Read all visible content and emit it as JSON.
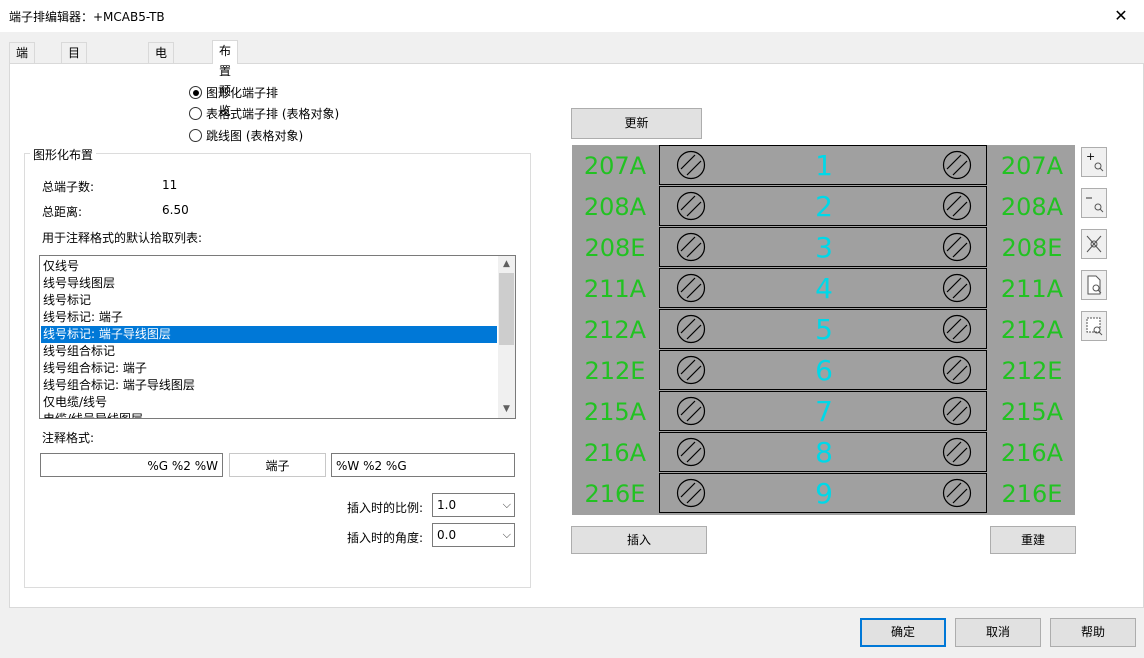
{
  "window": {
    "title": "端子排编辑器：+MCAB5-TB",
    "close_icon": "close-icon"
  },
  "tabs": [
    {
      "label": "端子排"
    },
    {
      "label": "目录代号指定"
    },
    {
      "label": "电缆信息"
    },
    {
      "label": "布置预览",
      "active": true
    }
  ],
  "layout_options": {
    "items": [
      {
        "label": "图形化端子排",
        "selected": true
      },
      {
        "label": "表格式端子排 (表格对象)",
        "selected": false
      },
      {
        "label": "跳线图 (表格对象)",
        "selected": false
      }
    ]
  },
  "graphic_layout": {
    "title": "图形化布置",
    "total_terminals_label": "总端子数:",
    "total_terminals_value": "11",
    "total_distance_label": "总距离:",
    "total_distance_value": "6.50",
    "pick_list_label": "用于注释格式的默认拾取列表:",
    "pick_list": [
      "仅线号",
      "线号导线图层",
      "线号标记",
      "线号标记: 端子",
      "线号标记: 端子导线图层",
      "线号组合标记",
      "线号组合标记: 端子",
      "线号组合标记: 端子导线图层",
      "仅电缆/线号",
      "电缆/线号导线图层"
    ],
    "pick_list_selected_index": 4,
    "annotation_label": "注释格式:",
    "annotation_left": "%G %2 %W",
    "annotation_middle": "端子",
    "annotation_right": "%W %2 %G",
    "insert_scale_label": "插入时的比例:",
    "insert_scale_value": "1.0",
    "insert_angle_label": "插入时的角度:",
    "insert_angle_value": "0.0"
  },
  "preview": {
    "refresh_label": "更新",
    "insert_label": "插入",
    "rebuild_label": "重建",
    "colors": {
      "background": "#a0a0a0",
      "number": "#00d8e8",
      "wire_label": "#22c222"
    },
    "rows": [
      {
        "num": "1",
        "left": "207A",
        "right": "207A"
      },
      {
        "num": "2",
        "left": "208A",
        "right": "208A"
      },
      {
        "num": "3",
        "left": "208E",
        "right": "208E"
      },
      {
        "num": "4",
        "left": "211A",
        "right": "211A"
      },
      {
        "num": "5",
        "left": "212A",
        "right": "212A"
      },
      {
        "num": "6",
        "left": "212E",
        "right": "212E"
      },
      {
        "num": "7",
        "left": "215A",
        "right": "215A"
      },
      {
        "num": "8",
        "left": "216A",
        "right": "216A"
      },
      {
        "num": "9",
        "left": "216E",
        "right": "216E"
      }
    ],
    "zoom_tools": [
      "zoom-in-icon",
      "zoom-out-icon",
      "zoom-extents-icon",
      "zoom-page-icon",
      "zoom-window-icon"
    ]
  },
  "footer": {
    "ok_label": "确定",
    "cancel_label": "取消",
    "help_label": "帮助"
  }
}
